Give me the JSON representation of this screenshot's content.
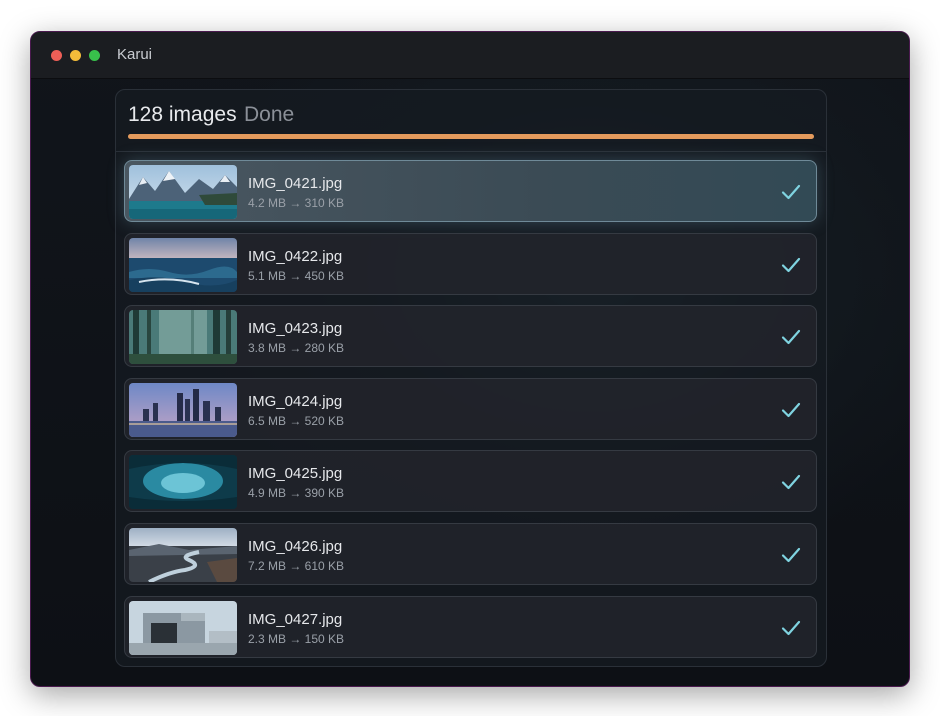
{
  "window": {
    "title": "Karui"
  },
  "header": {
    "count_label": "128 images",
    "status": "Done",
    "progress": 1.0,
    "accent_color": "#e49a5c"
  },
  "files": [
    {
      "name": "IMG_0421.jpg",
      "sizes": "4.2 MB → 310 KB",
      "thumbnail": "mountain-lake",
      "selected": true
    },
    {
      "name": "IMG_0422.jpg",
      "sizes": "5.1 MB → 450 KB",
      "thumbnail": "ocean-waves",
      "selected": false
    },
    {
      "name": "IMG_0423.jpg",
      "sizes": "3.8 MB → 280 KB",
      "thumbnail": "misty-forest",
      "selected": false
    },
    {
      "name": "IMG_0424.jpg",
      "sizes": "6.5 MB → 520 KB",
      "thumbnail": "city-skyline",
      "selected": false
    },
    {
      "name": "IMG_0425.jpg",
      "sizes": "4.9 MB → 390 KB",
      "thumbnail": "ice-cave",
      "selected": false
    },
    {
      "name": "IMG_0426.jpg",
      "sizes": "7.2 MB → 610 KB",
      "thumbnail": "river-valley",
      "selected": false
    },
    {
      "name": "IMG_0427.jpg",
      "sizes": "2.3 MB → 150 KB",
      "thumbnail": "concrete-building",
      "selected": false
    }
  ],
  "icons": {
    "done": "checkmark-icon",
    "check_color": "#7fd3e0"
  }
}
